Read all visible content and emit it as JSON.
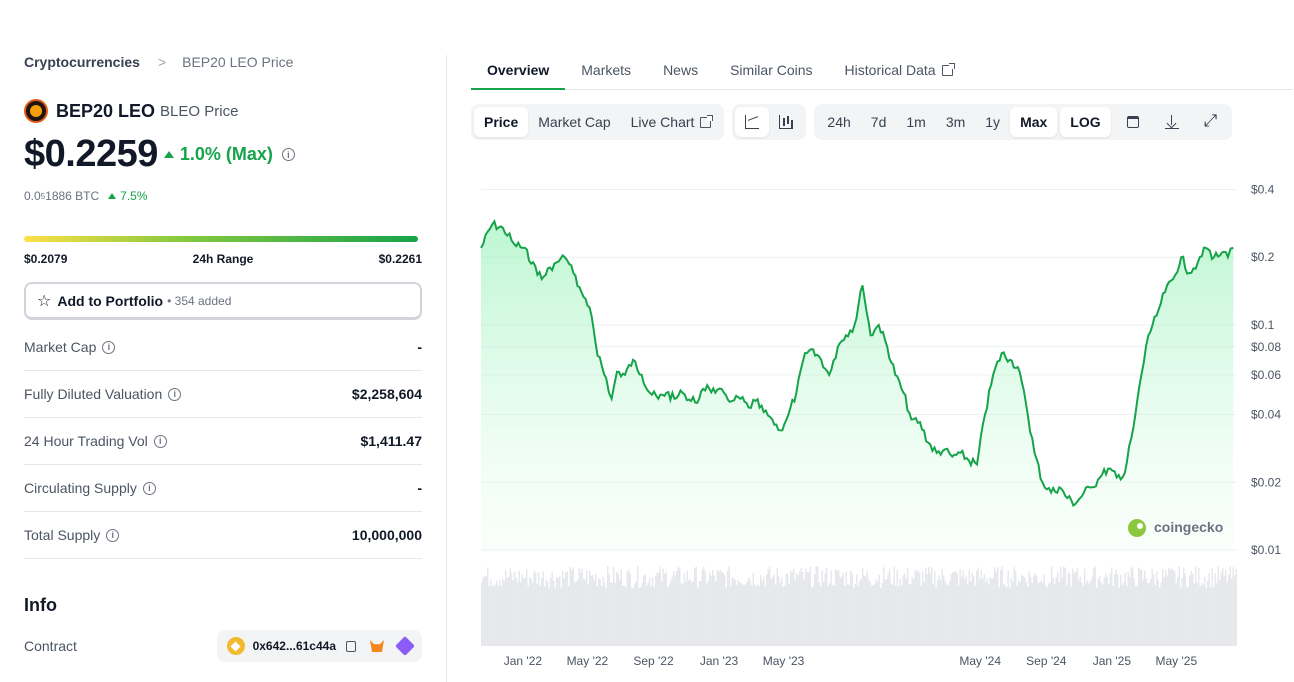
{
  "breadcrumb": {
    "parent": "Cryptocurrencies",
    "separator": ">",
    "current": "BEP20 LEO Price"
  },
  "coin": {
    "name": "BEP20 LEO",
    "symbol_label": "BLEO Price"
  },
  "price": {
    "value": "$0.2259",
    "change": "1.0% (Max)"
  },
  "btc": {
    "prefix": "0.0",
    "sub": "5",
    "suffix": "1886 BTC",
    "change": "7.5%"
  },
  "range": {
    "low": "$0.2079",
    "label": "24h Range",
    "high": "$0.2261"
  },
  "portfolio": {
    "label": "Add to Portfolio",
    "count": "• 354 added"
  },
  "stats": [
    {
      "label": "Market Cap",
      "value": "-"
    },
    {
      "label": "Fully Diluted Valuation",
      "value": "$2,258,604"
    },
    {
      "label": "24 Hour Trading Vol",
      "value": "$1,411.47"
    },
    {
      "label": "Circulating Supply",
      "value": "-"
    },
    {
      "label": "Total Supply",
      "value": "10,000,000"
    }
  ],
  "info": {
    "title": "Info",
    "contract_label": "Contract",
    "contract_address": "0x642...61c44a"
  },
  "tabs": [
    "Overview",
    "Markets",
    "News",
    "Similar Coins",
    "Historical Data"
  ],
  "toolbar": {
    "chart_types": [
      "Price",
      "Market Cap",
      "Live Chart"
    ],
    "ranges": [
      "24h",
      "7d",
      "1m",
      "3m",
      "1y",
      "Max"
    ],
    "log": "LOG"
  },
  "colors": {
    "accent": "#16a34a",
    "line": "#16a34a",
    "area": "#bbf7d0",
    "volume": "#e5e7eb"
  },
  "icons": [
    "info-icon",
    "star-icon",
    "external-link-icon",
    "line-chart-icon",
    "candlestick-icon",
    "calendar-icon",
    "download-icon",
    "fullscreen-icon",
    "copy-icon",
    "metamask-icon",
    "wallet-icon",
    "bnb-chain-icon"
  ],
  "watermark": "coingecko",
  "chart_data": {
    "type": "area",
    "scale": "log",
    "ylim": [
      0.01,
      0.45
    ],
    "y_ticks": [
      "$0.4",
      "$0.2",
      "$0.1",
      "$0.08",
      "$0.06",
      "$0.04",
      "$0.02",
      "$0.01"
    ],
    "y_tick_values": [
      0.4,
      0.2,
      0.1,
      0.08,
      0.06,
      0.04,
      0.02,
      0.01
    ],
    "x_ticks": [
      "Jan '22",
      "May '22",
      "Sep '22",
      "Jan '23",
      "May '23",
      "May '24",
      "Sep '24",
      "Jan '25",
      "May '25"
    ],
    "x_tick_dates": [
      "2022-01-01",
      "2022-05-01",
      "2022-09-01",
      "2023-01-01",
      "2023-05-01",
      "2024-05-01",
      "2024-09-01",
      "2025-01-01",
      "2025-05-01"
    ],
    "x_range": [
      "2021-10-15",
      "2025-08-20"
    ],
    "series": [
      {
        "x": [
          "2021-10-15",
          "2021-11-05",
          "2021-11-25",
          "2021-12-15",
          "2022-01-01",
          "2022-01-20",
          "2022-02-05",
          "2022-02-20",
          "2022-03-05",
          "2022-03-20",
          "2022-04-05",
          "2022-04-20",
          "2022-05-05",
          "2022-05-20",
          "2022-06-05",
          "2022-06-15",
          "2022-06-25",
          "2022-07-10",
          "2022-07-25",
          "2022-08-10",
          "2022-08-25",
          "2022-09-10",
          "2022-09-25",
          "2022-10-10",
          "2022-10-25",
          "2022-11-10",
          "2022-11-25",
          "2022-12-10",
          "2022-12-25",
          "2023-01-10",
          "2023-01-25",
          "2023-02-10",
          "2023-02-25",
          "2023-03-10",
          "2023-03-25",
          "2023-04-10",
          "2023-04-25",
          "2023-05-10",
          "2023-05-25",
          "2023-06-10",
          "2023-06-25",
          "2023-07-10",
          "2023-07-25",
          "2023-08-10",
          "2023-08-25",
          "2023-09-10",
          "2023-09-25",
          "2023-10-10",
          "2023-10-25",
          "2023-11-10",
          "2023-11-25",
          "2023-12-10",
          "2023-12-25",
          "2024-01-10",
          "2024-01-25",
          "2024-02-10",
          "2024-02-25",
          "2024-03-10",
          "2024-03-25",
          "2024-04-10",
          "2024-04-25",
          "2024-05-10",
          "2024-05-25",
          "2024-06-10",
          "2024-06-25",
          "2024-07-10",
          "2024-07-25",
          "2024-08-10",
          "2024-08-25",
          "2024-09-10",
          "2024-09-25",
          "2024-10-10",
          "2024-10-25",
          "2024-11-10",
          "2024-11-25",
          "2024-12-10",
          "2024-12-25",
          "2025-01-10",
          "2025-01-25",
          "2025-02-10",
          "2025-02-25",
          "2025-03-10",
          "2025-03-25",
          "2025-04-10",
          "2025-04-25",
          "2025-05-10",
          "2025-05-25",
          "2025-06-10",
          "2025-06-25",
          "2025-07-10",
          "2025-07-25",
          "2025-08-05",
          "2025-08-15"
        ],
        "y": [
          0.22,
          0.28,
          0.27,
          0.23,
          0.22,
          0.19,
          0.16,
          0.18,
          0.19,
          0.2,
          0.17,
          0.14,
          0.12,
          0.073,
          0.058,
          0.047,
          0.062,
          0.06,
          0.07,
          0.06,
          0.05,
          0.047,
          0.05,
          0.047,
          0.05,
          0.046,
          0.047,
          0.054,
          0.05,
          0.05,
          0.046,
          0.047,
          0.043,
          0.046,
          0.041,
          0.038,
          0.034,
          0.04,
          0.05,
          0.075,
          0.078,
          0.07,
          0.06,
          0.08,
          0.09,
          0.1,
          0.15,
          0.09,
          0.1,
          0.08,
          0.06,
          0.05,
          0.038,
          0.037,
          0.03,
          0.027,
          0.028,
          0.026,
          0.027,
          0.025,
          0.024,
          0.04,
          0.06,
          0.075,
          0.07,
          0.065,
          0.045,
          0.027,
          0.02,
          0.018,
          0.019,
          0.017,
          0.016,
          0.018,
          0.019,
          0.021,
          0.023,
          0.021,
          0.022,
          0.035,
          0.06,
          0.09,
          0.11,
          0.14,
          0.16,
          0.2,
          0.17,
          0.19,
          0.22,
          0.2,
          0.21,
          0.2,
          0.22
        ]
      }
    ]
  }
}
